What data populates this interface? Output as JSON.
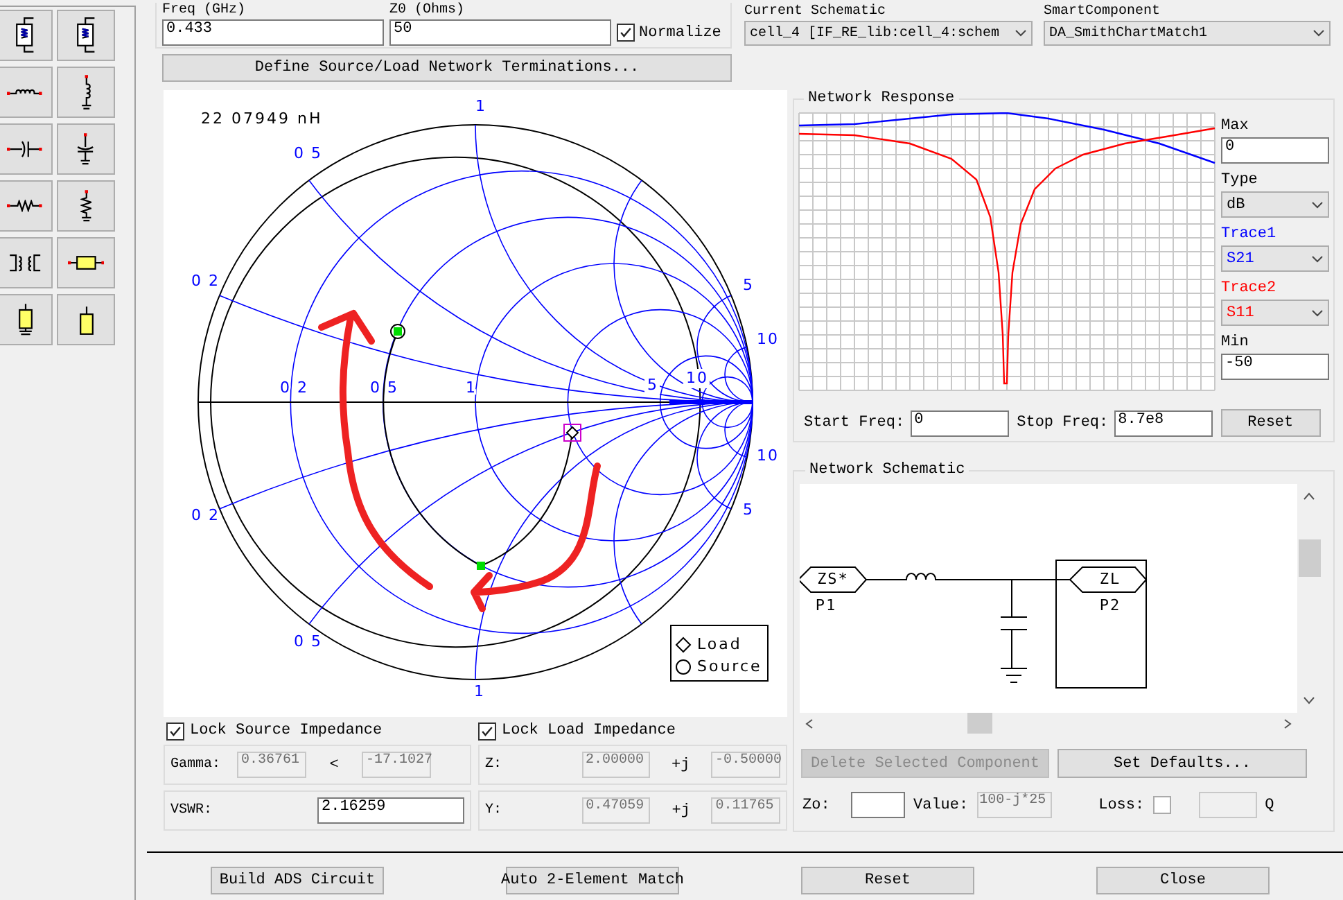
{
  "freq": {
    "label": "Freq (GHz)",
    "value": "0.433"
  },
  "z0": {
    "label": "Z0 (Ohms)",
    "value": "50"
  },
  "normalize": {
    "label": "Normalize",
    "checked": true
  },
  "current_schematic": {
    "label": "Current Schematic",
    "value": "cell_4 [IF_RE_lib:cell_4:schem"
  },
  "smart_component": {
    "label": "SmartComponent",
    "value": "DA_SmithChartMatch1"
  },
  "define_button": "Define Source/Load Network Terminations...",
  "smith_chart": {
    "readout": "22 07949 nH",
    "grid_labels": [
      "1",
      "0 5",
      "5",
      "0 2",
      "10",
      "0 2",
      "0 5",
      "1",
      "5",
      "10",
      "10",
      "5",
      "0 2",
      "0 5",
      "1"
    ],
    "legend": [
      "Load",
      "Source"
    ]
  },
  "lock_source": {
    "label": "Lock Source Impedance",
    "checked": true
  },
  "gamma": {
    "label": "Gamma:",
    "magnitude": {
      "value": "0.36761",
      "disabled": true
    },
    "angle_sign": "<",
    "angle": {
      "value": "-17.1027",
      "disabled": true
    }
  },
  "vswr": {
    "label": "VSWR:",
    "value": {
      "value": "2.16259",
      "disabled": false
    }
  },
  "lock_load": {
    "label": "Lock Load Impedance",
    "checked": true
  },
  "z": {
    "label": "Z:",
    "real": {
      "value": "2.00000",
      "disabled": true
    },
    "j": "+j",
    "imag": {
      "value": "-0.50000",
      "disabled": true
    }
  },
  "y": {
    "label": "Y:",
    "real": {
      "value": "0.47059",
      "disabled": true
    },
    "j": "+j",
    "imag": {
      "value": "0.11765",
      "disabled": true
    }
  },
  "network_response": {
    "title": "Network Response",
    "max": {
      "label": "Max",
      "value": "0"
    },
    "type": {
      "label": "Type",
      "value": "dB"
    },
    "traces": [
      {
        "label": "Trace1",
        "value": "S21",
        "color": "#0000ff"
      },
      {
        "label": "Trace2",
        "value": "S11",
        "color": "#ff0000"
      }
    ],
    "min": {
      "label": "Min",
      "value": "-50"
    },
    "start_freq": {
      "label": "Start Freq:",
      "value": "0"
    },
    "stop_freq": {
      "label": "Stop Freq:",
      "value": "8.7e8"
    },
    "reset": "Reset"
  },
  "network_schematic": {
    "title": "Network Schematic",
    "source": {
      "symbol": "ZS*",
      "port": "P1"
    },
    "load": {
      "symbol": "ZL",
      "port": "P2"
    },
    "delete_button": {
      "label": "Delete Selected Component",
      "disabled": true
    },
    "defaults_button": "Set Defaults...",
    "zo": {
      "label": "Zo:"
    },
    "value": {
      "label": "Value:",
      "value": "100-j*25"
    },
    "loss": {
      "label": "Loss:",
      "checked": false
    },
    "q": {
      "label": "Q"
    }
  },
  "footer_buttons": [
    "Build ADS Circuit",
    "Auto 2-Element Match",
    "Reset",
    "Close"
  ]
}
